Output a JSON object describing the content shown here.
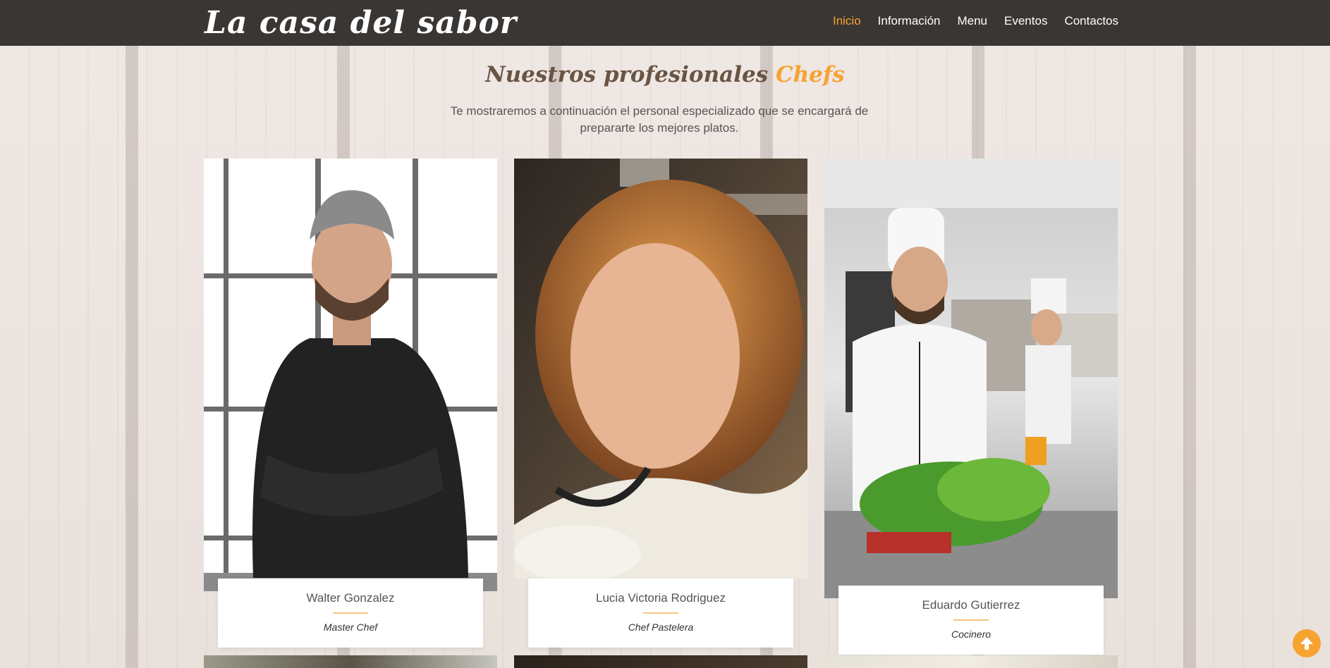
{
  "brand": {
    "title": "La casa del sabor"
  },
  "nav": {
    "items": [
      {
        "label": "Inicio",
        "active": true
      },
      {
        "label": "Información"
      },
      {
        "label": "Menu"
      },
      {
        "label": "Eventos"
      },
      {
        "label": "Contactos"
      }
    ]
  },
  "section": {
    "title_main": "Nuestros profesionales",
    "title_accent": "Chefs",
    "subtitle": "Te mostraremos a continuación el personal especializado que se encargará de prepararte los mejores platos."
  },
  "chefs": [
    {
      "name": "Walter Gonzalez",
      "role": "Master Chef"
    },
    {
      "name": "Lucia Victoria Rodriguez",
      "role": "Chef Pastelera"
    },
    {
      "name": "Eduardo Gutierrez",
      "role": "Cocinero"
    }
  ],
  "colors": {
    "accent": "#f7a332",
    "navbar": "#3a3634"
  },
  "icons": {
    "scroll_top": "arrow-up-icon"
  }
}
